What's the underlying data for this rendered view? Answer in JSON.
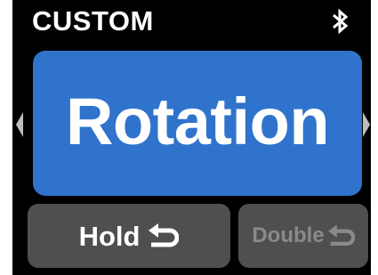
{
  "header": {
    "title": "CUSTOM",
    "status_icon": "bluetooth-icon"
  },
  "main": {
    "label": "Rotation",
    "color": "#2f73cc"
  },
  "navigation": {
    "left_icon": "chevron-left-icon",
    "right_icon": "chevron-right-icon"
  },
  "buttons": {
    "hold": {
      "label": "Hold",
      "icon": "return-icon",
      "state": "active"
    },
    "double": {
      "label": "Double",
      "icon": "return-icon",
      "state": "dimmed"
    }
  },
  "colors": {
    "background": "#000000",
    "button": "#4f4f4f",
    "dimmed_text": "#8a8a8a"
  }
}
